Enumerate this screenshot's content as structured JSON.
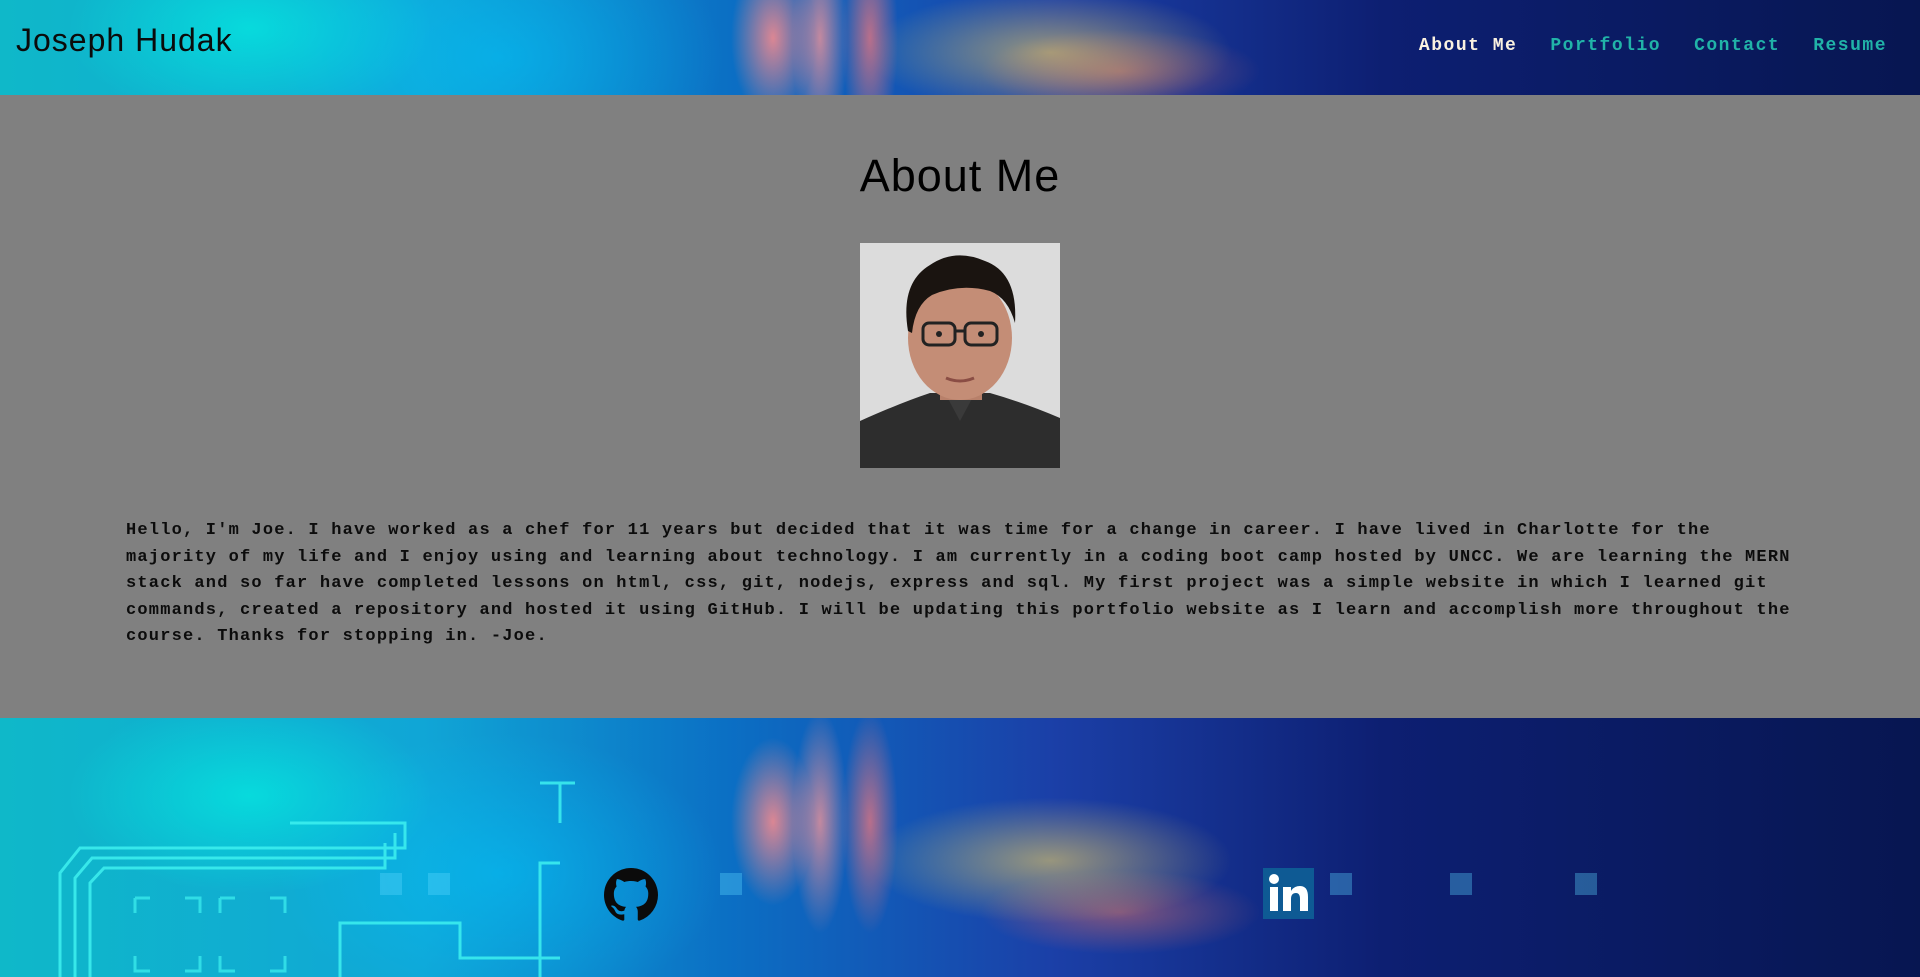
{
  "header": {
    "brand": "Joseph Hudak",
    "nav": [
      {
        "label": "About Me",
        "active": true
      },
      {
        "label": "Portfolio",
        "active": false
      },
      {
        "label": "Contact",
        "active": false
      },
      {
        "label": "Resume",
        "active": false
      }
    ]
  },
  "main": {
    "title": "About Me",
    "bio": "Hello, I'm Joe. I have worked as a chef for 11 years but decided that it was time for a change in career. I have lived in Charlotte for the majority of my life and I enjoy using and learning about technology. I am currently in a coding boot camp hosted by UNCC. We are learning the MERN stack and so far have completed lessons on html, css, git, nodejs, express and sql. My first project was a simple website in which I learned git commands, created a repository and hosted it using GitHub. I will be updating this portfolio website as I learn and accomplish more throughout the course. Thanks for stopping in. -Joe."
  },
  "footer": {
    "icons": [
      "github-icon",
      "linkedin-icon"
    ]
  },
  "colors": {
    "nav_link": "#21b3a8",
    "nav_active": "#fbf2e0",
    "main_bg": "#808080",
    "linkedin": "#0e5a94"
  }
}
